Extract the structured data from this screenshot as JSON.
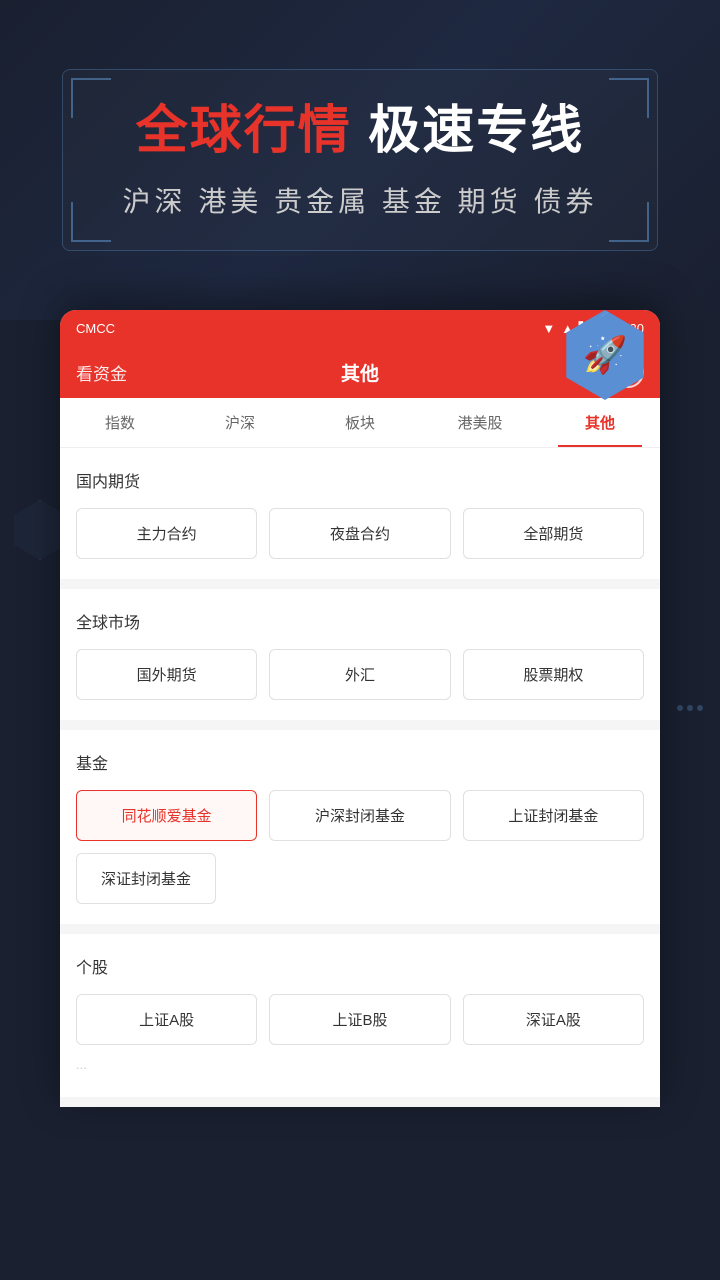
{
  "banner": {
    "title_highlight": "全球行情",
    "title_rest": " 极速专线",
    "subtitle": "沪深 港美 贵金属 基金 期货 债券"
  },
  "status_bar": {
    "carrier": "CMCC",
    "time": "12:30",
    "wifi": "▼",
    "signal": "41"
  },
  "nav": {
    "left": "看资金",
    "title": "其他",
    "search_icon": "🔍"
  },
  "tabs": [
    {
      "label": "指数",
      "active": false
    },
    {
      "label": "沪深",
      "active": false
    },
    {
      "label": "板块",
      "active": false
    },
    {
      "label": "港美股",
      "active": false
    },
    {
      "label": "其他",
      "active": true
    }
  ],
  "sections": [
    {
      "id": "domestic_futures",
      "title": "国内期货",
      "buttons": [
        {
          "label": "主力合约",
          "selected": false
        },
        {
          "label": "夜盘合约",
          "selected": false
        },
        {
          "label": "全部期货",
          "selected": false
        }
      ]
    },
    {
      "id": "global_market",
      "title": "全球市场",
      "buttons": [
        {
          "label": "国外期货",
          "selected": false
        },
        {
          "label": "外汇",
          "selected": false
        },
        {
          "label": "股票期权",
          "selected": false
        }
      ]
    },
    {
      "id": "fund",
      "title": "基金",
      "buttons": [
        {
          "label": "同花顺爱基金",
          "selected": true
        },
        {
          "label": "沪深封闭基金",
          "selected": false
        },
        {
          "label": "上证封闭基金",
          "selected": false
        },
        {
          "label": "深证封闭基金",
          "selected": false
        }
      ]
    },
    {
      "id": "individual_stock",
      "title": "个股",
      "buttons": [
        {
          "label": "上证A股",
          "selected": false
        },
        {
          "label": "上证B股",
          "selected": false
        },
        {
          "label": "深证A股",
          "selected": false
        }
      ]
    }
  ]
}
